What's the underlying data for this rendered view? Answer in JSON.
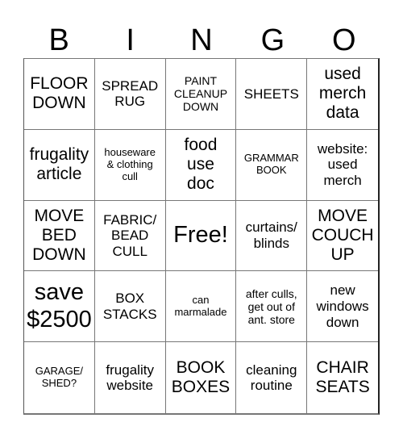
{
  "header": {
    "letters": [
      "B",
      "I",
      "N",
      "G",
      "O"
    ]
  },
  "cells": [
    {
      "text": "FLOOR\nDOWN",
      "size": "l"
    },
    {
      "text": "SPREAD\nRUG",
      "size": "m"
    },
    {
      "text": "PAINT\nCLEANUP\nDOWN",
      "size": "s"
    },
    {
      "text": "SHEETS",
      "size": "m"
    },
    {
      "text": "used\nmerch\ndata",
      "size": "l"
    },
    {
      "text": "frugality\narticle",
      "size": "l"
    },
    {
      "text": "houseware\n& clothing\ncull",
      "size": "xs"
    },
    {
      "text": "food\nuse\ndoc",
      "size": "l"
    },
    {
      "text": "GRAMMAR\nBOOK",
      "size": "xs"
    },
    {
      "text": "website:\nused\nmerch",
      "size": "m"
    },
    {
      "text": "MOVE\nBED\nDOWN",
      "size": "l"
    },
    {
      "text": "FABRIC/\nBEAD\nCULL",
      "size": "m"
    },
    {
      "text": "Free!",
      "size": "xl"
    },
    {
      "text": "curtains/\nblinds",
      "size": "m"
    },
    {
      "text": "MOVE\nCOUCH\nUP",
      "size": "l"
    },
    {
      "text": "save\n$2500",
      "size": "xl"
    },
    {
      "text": "BOX\nSTACKS",
      "size": "m"
    },
    {
      "text": "can\nmarmalade",
      "size": "xs"
    },
    {
      "text": "after culls,\nget out of\nant. store",
      "size": "s"
    },
    {
      "text": "new\nwindows\ndown",
      "size": "m"
    },
    {
      "text": "GARAGE/\nSHED?",
      "size": "xs"
    },
    {
      "text": "frugality\nwebsite",
      "size": "m"
    },
    {
      "text": "BOOK\nBOXES",
      "size": "l"
    },
    {
      "text": "cleaning\nroutine",
      "size": "m"
    },
    {
      "text": "CHAIR\nSEATS",
      "size": "l"
    }
  ]
}
